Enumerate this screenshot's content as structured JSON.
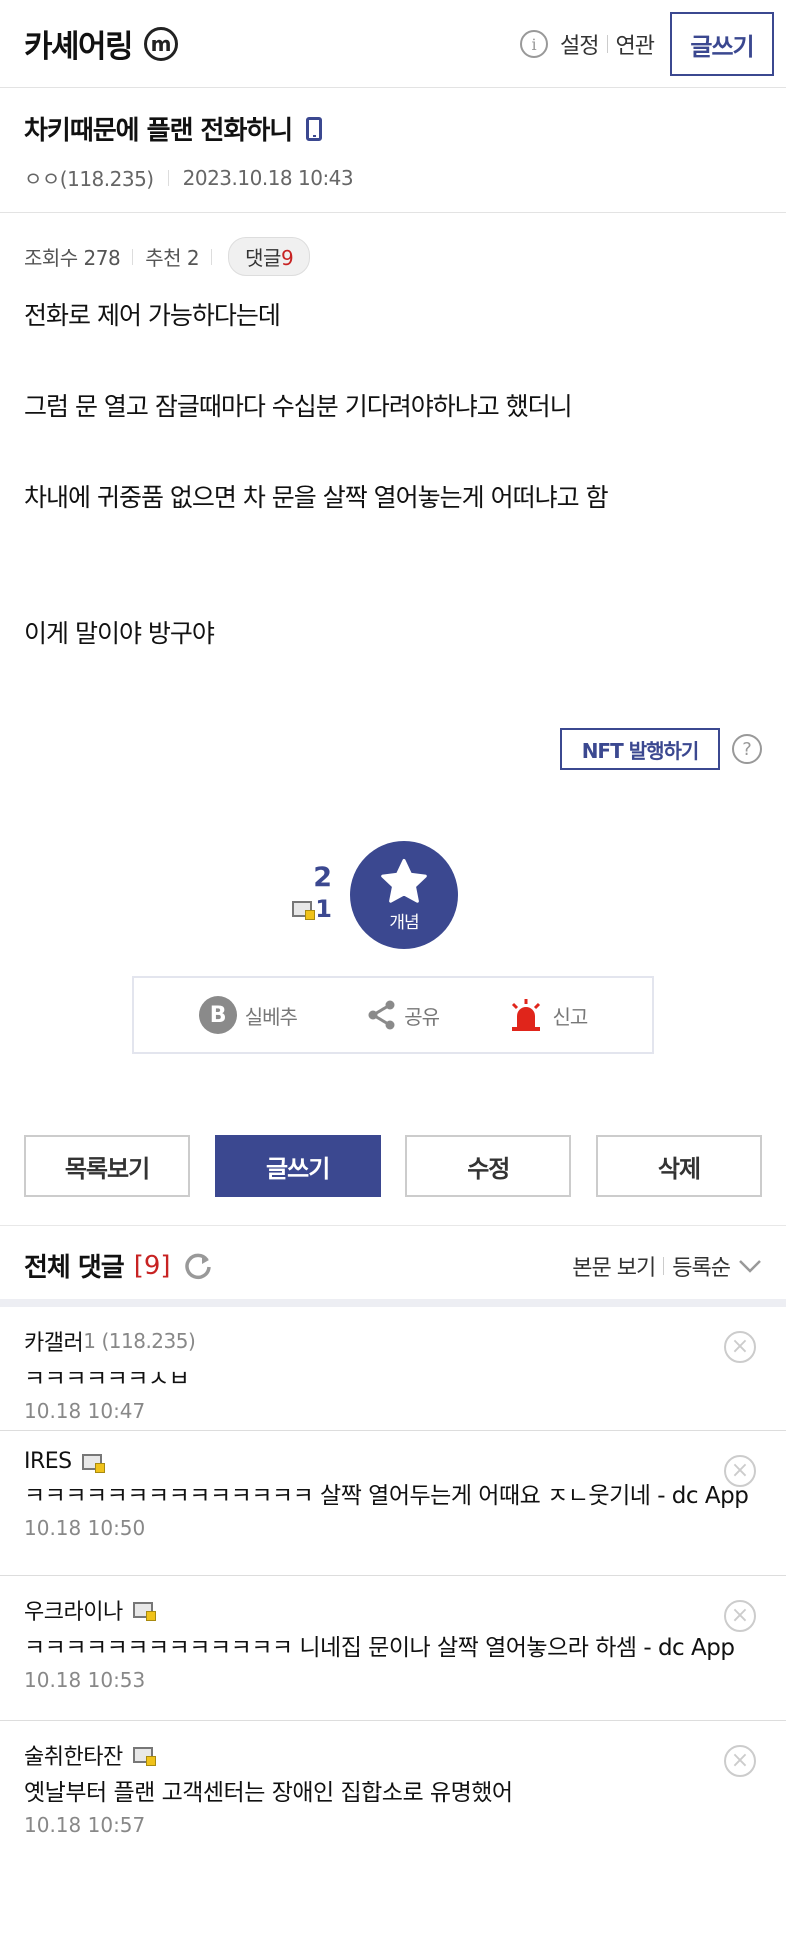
{
  "header": {
    "gallery_title": "카셰어링",
    "minor_badge": "m",
    "info_icon": "info-icon",
    "settings_label": "설정",
    "related_label": "연관",
    "write_label": "글쓰기"
  },
  "post": {
    "title": "차키때문에 플랜 전화하니",
    "author": "ㅇㅇ(118.235)",
    "date": "2023.10.18 10:43",
    "views": "조회수 278",
    "recommend": "추천 2",
    "comments_label": "댓글",
    "comments_count": "9",
    "body": [
      "전화로 제어 가능하다는데",
      "그럼 문 열고 잠글때마다 수십분 기다려야하냐고 했더니",
      "차내에 귀중품 없으면 차 문을 살짝 열어놓는게 어떠냐고 함",
      "이게 말이야 방구야"
    ]
  },
  "nft": {
    "label": "NFT 발행하기",
    "help": "?"
  },
  "recommend_box": {
    "up_count": "2",
    "fix_count": "1",
    "button_label": "개념"
  },
  "actions": {
    "silbe_label": "실베추",
    "share_label": "공유",
    "report_label": "신고"
  },
  "buttons": {
    "list": "목록보기",
    "write": "글쓰기",
    "edit": "수정",
    "delete": "삭제"
  },
  "comments_section": {
    "title": "전체 댓글",
    "count": "[9]",
    "view_body": "본문 보기",
    "sort": "등록순"
  },
  "comments": [
    {
      "name": "카갤러",
      "gcount": "1",
      "ip": "(118.235)",
      "fixed": false,
      "text": "ㅋㅋㅋㅋㅋㅋㅅㅂ",
      "date": "10.18 10:47"
    },
    {
      "name": "IRES",
      "gcount": "",
      "ip": "",
      "fixed": true,
      "text": "ㅋㅋㅋㅋㅋㅋㅋㅋㅋㅋㅋㅋㅋㅋ 살짝 열어두는게 어때요 ㅈㄴ웃기네 - dc App",
      "date": "10.18 10:50"
    },
    {
      "name": "우크라이나",
      "gcount": "",
      "ip": "",
      "fixed": true,
      "text": "ㅋㅋㅋㅋㅋㅋㅋㅋㅋㅋㅋㅋㅋ 니네집 문이나 살짝 열어놓으라 하셈 - dc App",
      "date": "10.18 10:53"
    },
    {
      "name": "술취한타잔",
      "gcount": "",
      "ip": "",
      "fixed": true,
      "text": "옛날부터 플랜 고객센터는 장애인 집합소로 유명했어",
      "date": "10.18 10:57"
    }
  ],
  "colors": {
    "accent": "#3b4890",
    "comment_count": "#c72222",
    "report_red": "#e0251b"
  }
}
